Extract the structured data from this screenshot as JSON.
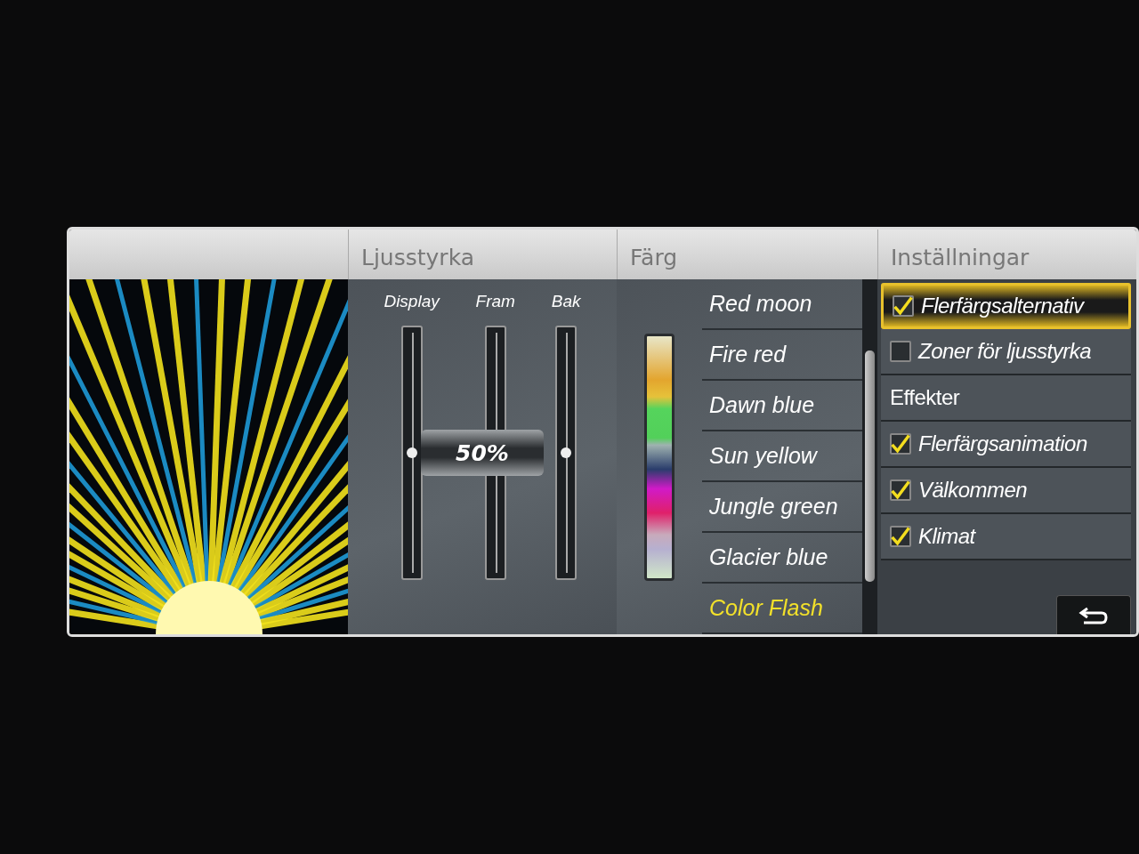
{
  "brightness": {
    "title": "Ljusstyrka",
    "reading": "50%",
    "sliders": [
      {
        "label": "Display",
        "level": 0.5
      },
      {
        "label": "Fram",
        "level": 0.5
      },
      {
        "label": "Bak",
        "level": 0.5
      }
    ]
  },
  "color": {
    "title": "Färg",
    "options": [
      {
        "label": "Red moon",
        "selected": false
      },
      {
        "label": "Fire red",
        "selected": false
      },
      {
        "label": "Dawn blue",
        "selected": false
      },
      {
        "label": "Sun yellow",
        "selected": false
      },
      {
        "label": "Jungle green",
        "selected": false
      },
      {
        "label": "Glacier blue",
        "selected": false
      },
      {
        "label": "Color Flash",
        "selected": true
      }
    ]
  },
  "settings": {
    "title": "Inställningar",
    "items": [
      {
        "kind": "checkbox",
        "label": "Flerfärgsalternativ",
        "checked": true,
        "selected": true
      },
      {
        "kind": "checkbox",
        "label": "Zoner för ljusstyrka",
        "checked": false,
        "selected": false
      },
      {
        "kind": "heading",
        "label": "Effekter"
      },
      {
        "kind": "checkbox",
        "label": "Flerfärgsanimation",
        "checked": true,
        "selected": false
      },
      {
        "kind": "checkbox",
        "label": "Välkommen",
        "checked": true,
        "selected": false
      },
      {
        "kind": "checkbox",
        "label": "Klimat",
        "checked": true,
        "selected": false
      }
    ]
  }
}
